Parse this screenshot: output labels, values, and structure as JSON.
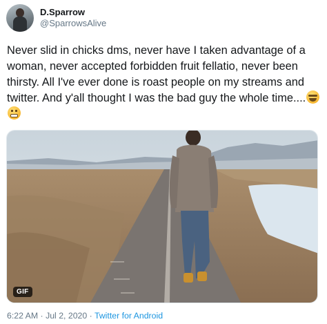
{
  "author": {
    "display_name": "D.Sparrow",
    "handle": "@SparrowsAlive",
    "avatar_icon": "user-avatar"
  },
  "tweet": {
    "text": "Never slid in chicks dms, never have I taken advantage of a woman, never accepted forbidden fruit fellatio, never been thirsty. All I've ever done is roast people on my streams and twitter. And y'all thought I was the bad guy the whole time....",
    "emojis": [
      "grinning-face-with-sweat",
      "grimacing-face"
    ]
  },
  "media": {
    "type": "gif",
    "badge": "GIF",
    "description_icon": "man-walking-on-desert-road"
  },
  "meta": {
    "time": "6:22 AM",
    "separator1": " · ",
    "date": "Jul 2, 2020",
    "separator2": " · ",
    "source": "Twitter for Android"
  },
  "colors": {
    "text": "#14171a",
    "secondary": "#657786",
    "link": "#1b95e0"
  }
}
